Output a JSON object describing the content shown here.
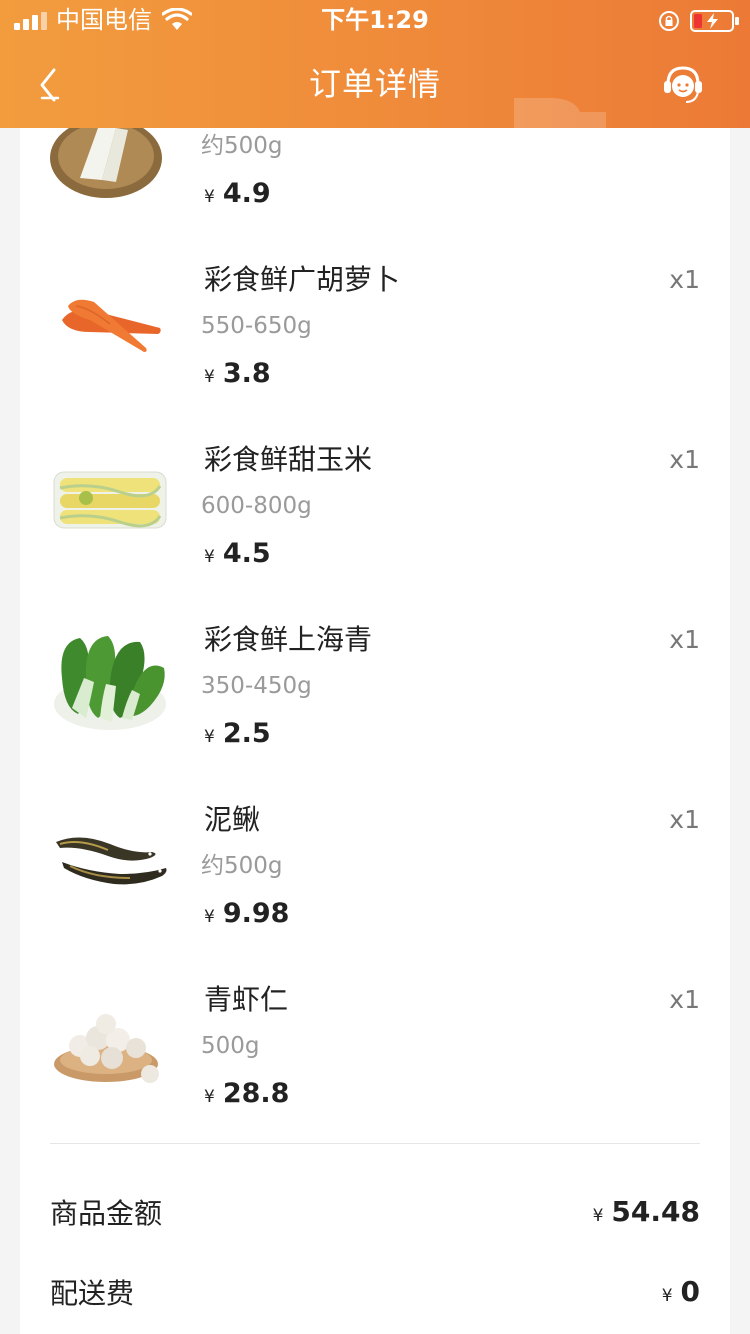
{
  "status_bar": {
    "carrier": "中国电信",
    "time": "下午1:29"
  },
  "header": {
    "title": "订单详情",
    "back_icon": "chevron-left-icon",
    "service_icon": "customer-service-icon"
  },
  "colors": {
    "header_start": "#f29c3e",
    "header_end": "#ec7a36",
    "text": "#222222",
    "secondary_text": "#9a9a9a"
  },
  "currency_symbol": "¥",
  "products": [
    {
      "name": "",
      "spec": "约500g",
      "price": "4.9",
      "qty": ""
    },
    {
      "name": "彩食鲜广胡萝卜",
      "spec": "550-650g",
      "price": "3.8",
      "qty": "x1"
    },
    {
      "name": "彩食鲜甜玉米",
      "spec": "600-800g",
      "price": "4.5",
      "qty": "x1"
    },
    {
      "name": "彩食鲜上海青",
      "spec": "350-450g",
      "price": "2.5",
      "qty": "x1"
    },
    {
      "name": "泥鳅",
      "spec": "约500g",
      "price": "9.98",
      "qty": "x1"
    },
    {
      "name": "青虾仁",
      "spec": "500g",
      "price": "28.8",
      "qty": "x1"
    }
  ],
  "summary": {
    "goods_amount_label": "商品金额",
    "goods_amount": "54.48",
    "delivery_fee_label": "配送费",
    "delivery_fee": "0"
  }
}
